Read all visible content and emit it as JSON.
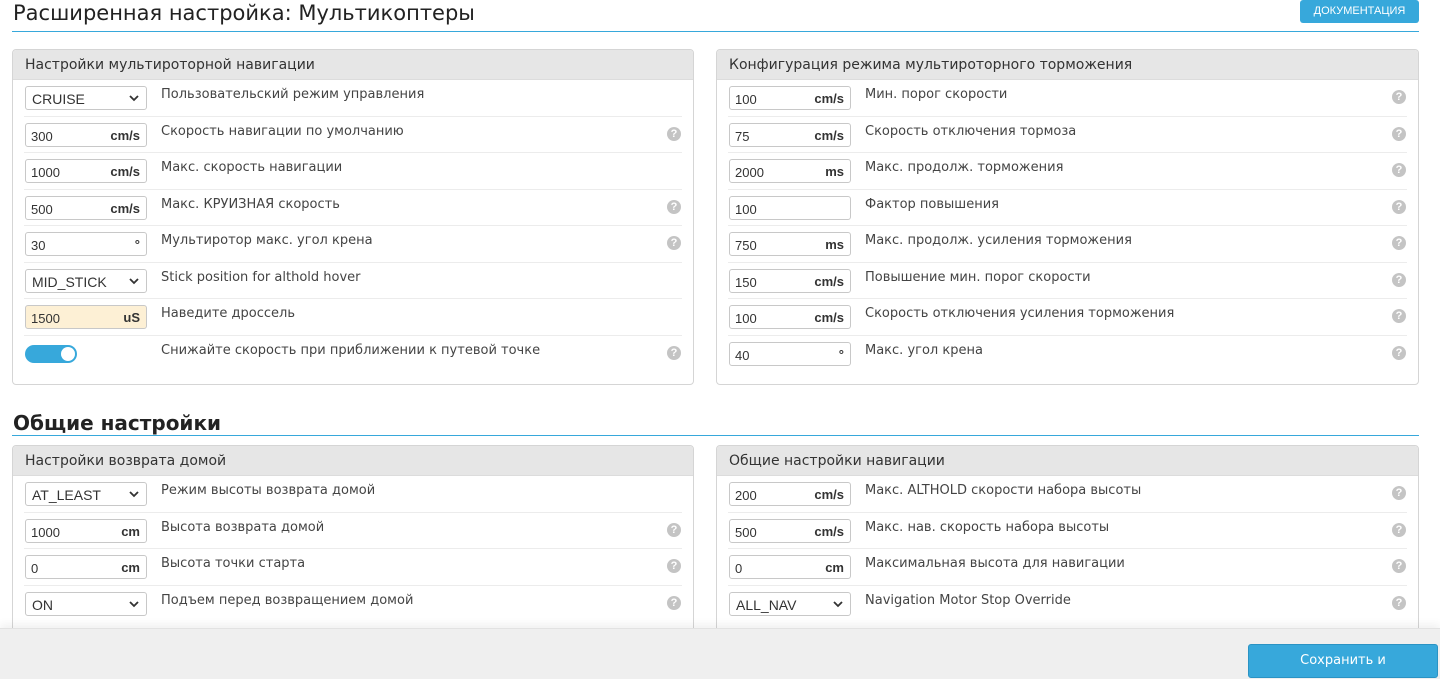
{
  "header": {
    "title": "Расширенная настройка: Мультикоптеры",
    "doc_button": "ДОКУМЕНТАЦИЯ"
  },
  "section_general": {
    "title": "Общие настройки"
  },
  "panels": {
    "nav": {
      "title": "Настройки мультироторной навигации",
      "rows": [
        {
          "type": "select",
          "value": "CRUISE",
          "label": "Пользовательский режим управления",
          "help": false
        },
        {
          "type": "number",
          "value": "300",
          "unit": "cm/s",
          "label": "Скорость навигации по умолчанию",
          "help": true
        },
        {
          "type": "number",
          "value": "1000",
          "unit": "cm/s",
          "label": "Макс. скорость навигации",
          "help": false
        },
        {
          "type": "number",
          "value": "500",
          "unit": "cm/s",
          "label": "Макс. КРУИЗНАЯ скорость",
          "help": true
        },
        {
          "type": "number",
          "value": "30",
          "unit": "°",
          "label": "Мультиротор макс. угол крена",
          "help": true
        },
        {
          "type": "select",
          "value": "MID_STICK",
          "label": "Stick position for althold hover",
          "help": false
        },
        {
          "type": "number",
          "value": "1500",
          "unit": "uS",
          "label": "Наведите дроссель",
          "help": false,
          "warn": true
        },
        {
          "type": "toggle",
          "value": "on",
          "label": "Снижайте скорость при приближении к путевой точке",
          "help": true
        }
      ]
    },
    "brake": {
      "title": "Конфигурация режима мультироторного торможения",
      "rows": [
        {
          "type": "number",
          "value": "100",
          "unit": "cm/s",
          "label": "Мин. порог скорости",
          "help": true
        },
        {
          "type": "number",
          "value": "75",
          "unit": "cm/s",
          "label": "Скорость отключения тормоза",
          "help": true
        },
        {
          "type": "number",
          "value": "2000",
          "unit": "ms",
          "label": "Макс. продолж. торможения",
          "help": true
        },
        {
          "type": "number",
          "value": "100",
          "unit": "",
          "label": "Фактор повышения",
          "help": true
        },
        {
          "type": "number",
          "value": "750",
          "unit": "ms",
          "label": "Макс. продолж. усиления торможения",
          "help": true
        },
        {
          "type": "number",
          "value": "150",
          "unit": "cm/s",
          "label": "Повышение мин. порог скорости",
          "help": true
        },
        {
          "type": "number",
          "value": "100",
          "unit": "cm/s",
          "label": "Скорость отключения усиления торможения",
          "help": true
        },
        {
          "type": "number",
          "value": "40",
          "unit": "°",
          "label": "Макс. угол крена",
          "help": true
        }
      ]
    },
    "rth": {
      "title": "Настройки возврата домой",
      "rows": [
        {
          "type": "select",
          "value": "AT_LEAST",
          "label": "Режим высоты возврата домой",
          "help": false
        },
        {
          "type": "number",
          "value": "1000",
          "unit": "cm",
          "label": "Высота возврата домой",
          "help": true
        },
        {
          "type": "number",
          "value": "0",
          "unit": "cm",
          "label": "Высота точки старта",
          "help": true
        },
        {
          "type": "select",
          "value": "ON",
          "label": "Подъем перед возвращением домой",
          "help": true
        }
      ]
    },
    "general_nav": {
      "title": "Общие настройки навигации",
      "rows": [
        {
          "type": "number",
          "value": "200",
          "unit": "cm/s",
          "label": "Макс. ALTHOLD скорости набора высоты",
          "help": true
        },
        {
          "type": "number",
          "value": "500",
          "unit": "cm/s",
          "label": "Макс. нав. скорость набора высоты",
          "help": true
        },
        {
          "type": "number",
          "value": "0",
          "unit": "cm",
          "label": "Максимальная высота для навигации",
          "help": true
        },
        {
          "type": "select",
          "value": "ALL_NAV",
          "label": "Navigation Motor Stop Override",
          "help": true
        }
      ]
    }
  },
  "footer": {
    "save_button": "Сохранить и перезагрузить"
  },
  "icons": {
    "help": "question-circle-icon",
    "dropdown": "chevron-down-icon"
  },
  "colors": {
    "accent": "#37a8db",
    "warn_field": "#fdf0d5"
  }
}
